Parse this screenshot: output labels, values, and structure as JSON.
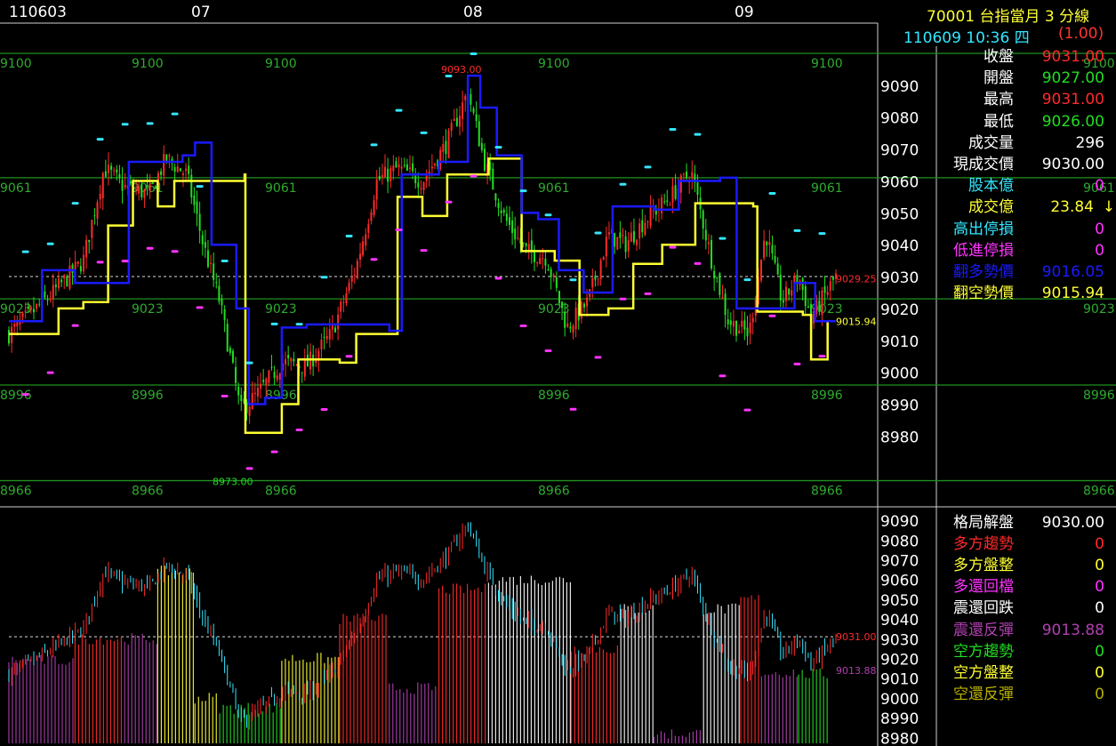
{
  "header": {
    "symbol_title": "70001  台指當月 3 分線",
    "datetime": "110609 10:36 四",
    "change": "(1.00)"
  },
  "colors": {
    "up": "#ff2a2a",
    "down": "#22dd22",
    "yellow": "#ffff33",
    "blue": "#1a1aff",
    "cyan": "#33e6ff",
    "magenta": "#ff33ff",
    "grid_green": "#1f8f1f",
    "white": "#ffffff",
    "purple": "#b040b0",
    "olive": "#b8b000"
  },
  "info_panel": [
    {
      "label": "收盤",
      "value": "9031.00",
      "label_color": "white",
      "value_color": "up"
    },
    {
      "label": "開盤",
      "value": "9027.00",
      "label_color": "white",
      "value_color": "down"
    },
    {
      "label": "最高",
      "value": "9031.00",
      "label_color": "white",
      "value_color": "up"
    },
    {
      "label": "最低",
      "value": "9026.00",
      "label_color": "white",
      "value_color": "down"
    },
    {
      "label": "成交量",
      "value": "296",
      "label_color": "white",
      "value_color": "white"
    },
    {
      "label": "現成交價",
      "value": "9030.00",
      "label_color": "white",
      "value_color": "white"
    },
    {
      "label": "股本億",
      "value": "0",
      "label_color": "cyan",
      "value_color": "magenta"
    },
    {
      "label": "成交億",
      "value": "23.84",
      "label_color": "yellow",
      "value_color": "yellow",
      "arrow": "↓"
    },
    {
      "label": "高出停損",
      "value": "0",
      "label_color": "cyan",
      "value_color": "magenta"
    },
    {
      "label": "低進停損",
      "value": "0",
      "label_color": "magenta",
      "value_color": "magenta"
    },
    {
      "label": "翻多勢價",
      "value": "9016.05",
      "label_color": "blue",
      "value_color": "blue"
    },
    {
      "label": "翻空勢價",
      "value": "9015.94",
      "label_color": "yellow",
      "value_color": "yellow"
    }
  ],
  "bottom_panel": [
    {
      "label": "格局解盤",
      "value": "9030.00",
      "label_color": "white",
      "value_color": "white"
    },
    {
      "label": "多方趨勢",
      "value": "0",
      "label_color": "up",
      "value_color": "up"
    },
    {
      "label": "多方盤整",
      "value": "0",
      "label_color": "yellow",
      "value_color": "yellow"
    },
    {
      "label": "多還回檔",
      "value": "0",
      "label_color": "magenta",
      "value_color": "magenta"
    },
    {
      "label": "震還回跌",
      "value": "0",
      "label_color": "white",
      "value_color": "white"
    },
    {
      "label": "震還反彈",
      "value": "9013.88",
      "label_color": "purple",
      "value_color": "purple"
    },
    {
      "label": "空方趨勢",
      "value": "0",
      "label_color": "down",
      "value_color": "down"
    },
    {
      "label": "空方盤整",
      "value": "0",
      "label_color": "yellow",
      "value_color": "yellow"
    },
    {
      "label": "空還反彈",
      "value": "0",
      "label_color": "olive",
      "value_color": "olive"
    }
  ],
  "chart_data": [
    {
      "type": "candlestick",
      "x_labels": [
        "110603",
        "07",
        "08",
        "09"
      ],
      "y_ticks": [
        8980,
        8990,
        9000,
        9010,
        9020,
        9030,
        9040,
        9050,
        9060,
        9070,
        9080,
        9090
      ],
      "ylim": [
        8967,
        9100
      ],
      "levels": [
        {
          "value": 9100,
          "label": "9100"
        },
        {
          "value": 9061,
          "label": "9061"
        },
        {
          "value": 9023,
          "label": "9023"
        },
        {
          "value": 8996,
          "label": "8996"
        },
        {
          "value": 8966,
          "label": "8966"
        }
      ],
      "annotations": [
        {
          "text": "9093.00",
          "value": 9093,
          "color": "up"
        },
        {
          "text": "8973.00",
          "value": 8973,
          "color": "down"
        },
        {
          "text": "9029.25",
          "value": 9029.25,
          "color": "up"
        },
        {
          "text": "9015.94",
          "value": 9015.94,
          "color": "yellow"
        }
      ],
      "close_anchors": [
        {
          "t": 0,
          "v": 9012
        },
        {
          "t": 0.05,
          "v": 9024
        },
        {
          "t": 0.09,
          "v": 9035
        },
        {
          "t": 0.115,
          "v": 9064
        },
        {
          "t": 0.14,
          "v": 9058
        },
        {
          "t": 0.17,
          "v": 9056
        },
        {
          "t": 0.19,
          "v": 9067
        },
        {
          "t": 0.215,
          "v": 9062
        },
        {
          "t": 0.235,
          "v": 9040
        },
        {
          "t": 0.255,
          "v": 9022
        },
        {
          "t": 0.28,
          "v": 8988
        },
        {
          "t": 0.3,
          "v": 8993
        },
        {
          "t": 0.33,
          "v": 9003
        },
        {
          "t": 0.36,
          "v": 9002
        },
        {
          "t": 0.39,
          "v": 9012
        },
        {
          "t": 0.42,
          "v": 9033
        },
        {
          "t": 0.445,
          "v": 9060
        },
        {
          "t": 0.47,
          "v": 9064
        },
        {
          "t": 0.5,
          "v": 9060
        },
        {
          "t": 0.53,
          "v": 9072
        },
        {
          "t": 0.555,
          "v": 9088
        },
        {
          "t": 0.575,
          "v": 9066
        },
        {
          "t": 0.6,
          "v": 9048
        },
        {
          "t": 0.625,
          "v": 9038
        },
        {
          "t": 0.65,
          "v": 9036
        },
        {
          "t": 0.675,
          "v": 9014
        },
        {
          "t": 0.7,
          "v": 9022
        },
        {
          "t": 0.725,
          "v": 9043
        },
        {
          "t": 0.745,
          "v": 9040
        },
        {
          "t": 0.77,
          "v": 9048
        },
        {
          "t": 0.8,
          "v": 9055
        },
        {
          "t": 0.825,
          "v": 9063
        },
        {
          "t": 0.85,
          "v": 9035
        },
        {
          "t": 0.87,
          "v": 9016
        },
        {
          "t": 0.895,
          "v": 9012
        },
        {
          "t": 0.915,
          "v": 9044
        },
        {
          "t": 0.935,
          "v": 9022
        },
        {
          "t": 0.955,
          "v": 9030
        },
        {
          "t": 0.97,
          "v": 9017
        },
        {
          "t": 1,
          "v": 9030
        }
      ],
      "yellow_line": [
        {
          "t": 0,
          "v": 9012
        },
        {
          "t": 0.04,
          "v": 9012
        },
        {
          "t": 0.06,
          "v": 9020
        },
        {
          "t": 0.09,
          "v": 9022
        },
        {
          "t": 0.12,
          "v": 9046
        },
        {
          "t": 0.15,
          "v": 9060
        },
        {
          "t": 0.18,
          "v": 9052
        },
        {
          "t": 0.2,
          "v": 9060
        },
        {
          "t": 0.285,
          "v": 9062
        },
        {
          "t": 0.286,
          "v": 8981
        },
        {
          "t": 0.31,
          "v": 8981
        },
        {
          "t": 0.33,
          "v": 8990
        },
        {
          "t": 0.35,
          "v": 9004
        },
        {
          "t": 0.4,
          "v": 9003
        },
        {
          "t": 0.42,
          "v": 9012
        },
        {
          "t": 0.47,
          "v": 9055
        },
        {
          "t": 0.5,
          "v": 9049
        },
        {
          "t": 0.53,
          "v": 9062
        },
        {
          "t": 0.58,
          "v": 9067
        },
        {
          "t": 0.62,
          "v": 9038
        },
        {
          "t": 0.66,
          "v": 9035
        },
        {
          "t": 0.69,
          "v": 9018
        },
        {
          "t": 0.725,
          "v": 9020
        },
        {
          "t": 0.755,
          "v": 9034
        },
        {
          "t": 0.79,
          "v": 9040
        },
        {
          "t": 0.83,
          "v": 9053
        },
        {
          "t": 0.9,
          "v": 9052
        },
        {
          "t": 0.905,
          "v": 9019
        },
        {
          "t": 0.96,
          "v": 9018
        },
        {
          "t": 0.97,
          "v": 9004
        },
        {
          "t": 0.985,
          "v": 9004
        },
        {
          "t": 0.99,
          "v": 9016
        },
        {
          "t": 1,
          "v": 9016
        }
      ],
      "blue_line": [
        {
          "t": 0,
          "v": 9016
        },
        {
          "t": 0.04,
          "v": 9032
        },
        {
          "t": 0.08,
          "v": 9028
        },
        {
          "t": 0.13,
          "v": 9028
        },
        {
          "t": 0.145,
          "v": 9066
        },
        {
          "t": 0.21,
          "v": 9068
        },
        {
          "t": 0.225,
          "v": 9072
        },
        {
          "t": 0.245,
          "v": 9040
        },
        {
          "t": 0.275,
          "v": 9020
        },
        {
          "t": 0.29,
          "v": 8990
        },
        {
          "t": 0.31,
          "v": 8992
        },
        {
          "t": 0.33,
          "v": 9014
        },
        {
          "t": 0.36,
          "v": 9015
        },
        {
          "t": 0.41,
          "v": 9015
        },
        {
          "t": 0.46,
          "v": 9013
        },
        {
          "t": 0.475,
          "v": 9062
        },
        {
          "t": 0.52,
          "v": 9066
        },
        {
          "t": 0.555,
          "v": 9093
        },
        {
          "t": 0.57,
          "v": 9083
        },
        {
          "t": 0.59,
          "v": 9068
        },
        {
          "t": 0.62,
          "v": 9050
        },
        {
          "t": 0.64,
          "v": 9048
        },
        {
          "t": 0.665,
          "v": 9032
        },
        {
          "t": 0.695,
          "v": 9025
        },
        {
          "t": 0.73,
          "v": 9052
        },
        {
          "t": 0.78,
          "v": 9051
        },
        {
          "t": 0.81,
          "v": 9060
        },
        {
          "t": 0.86,
          "v": 9061
        },
        {
          "t": 0.88,
          "v": 9020
        },
        {
          "t": 0.93,
          "v": 9020
        },
        {
          "t": 0.95,
          "v": 9028
        },
        {
          "t": 0.975,
          "v": 9016
        },
        {
          "t": 1,
          "v": 9016
        }
      ]
    },
    {
      "type": "bar",
      "y_ticks": [
        8980,
        8990,
        9000,
        9010,
        9020,
        9030,
        9040,
        9050,
        9060,
        9070,
        9080,
        9090
      ],
      "ylim": [
        8977,
        9095
      ],
      "annotations": [
        {
          "text": "9031.00",
          "value": 9031,
          "color": "up"
        },
        {
          "text": "9013.88",
          "value": 9013.88,
          "color": "purple"
        }
      ],
      "zones": [
        {
          "t0": 0.0,
          "t1": 0.08,
          "color": "purple",
          "top": 9019
        },
        {
          "t0": 0.08,
          "t1": 0.14,
          "color": "up",
          "top": 9030
        },
        {
          "t0": 0.14,
          "t1": 0.18,
          "color": "purple",
          "top": 9030
        },
        {
          "t0": 0.18,
          "t1": 0.225,
          "color": "yellow",
          "top": 9064
        },
        {
          "t0": 0.225,
          "t1": 0.255,
          "color": "yellow",
          "top": 9000
        },
        {
          "t0": 0.255,
          "t1": 0.33,
          "color": "down",
          "top": 8995
        },
        {
          "t0": 0.33,
          "t1": 0.4,
          "color": "yellow",
          "top": 9020
        },
        {
          "t0": 0.4,
          "t1": 0.46,
          "color": "up",
          "top": 9040
        },
        {
          "t0": 0.46,
          "t1": 0.52,
          "color": "purple",
          "top": 9005
        },
        {
          "t0": 0.52,
          "t1": 0.58,
          "color": "up",
          "top": 9055
        },
        {
          "t0": 0.58,
          "t1": 0.68,
          "color": "white",
          "top": 9060
        },
        {
          "t0": 0.68,
          "t1": 0.74,
          "color": "up",
          "top": 9025
        },
        {
          "t0": 0.74,
          "t1": 0.78,
          "color": "white",
          "top": 9045
        },
        {
          "t0": 0.78,
          "t1": 0.84,
          "color": "purple",
          "top": 8982
        },
        {
          "t0": 0.84,
          "t1": 0.885,
          "color": "white",
          "top": 9045
        },
        {
          "t0": 0.885,
          "t1": 0.91,
          "color": "up",
          "top": 9050
        },
        {
          "t0": 0.91,
          "t1": 0.955,
          "color": "purple",
          "top": 9013
        },
        {
          "t0": 0.955,
          "t1": 0.99,
          "color": "down",
          "top": 9012
        }
      ]
    }
  ]
}
